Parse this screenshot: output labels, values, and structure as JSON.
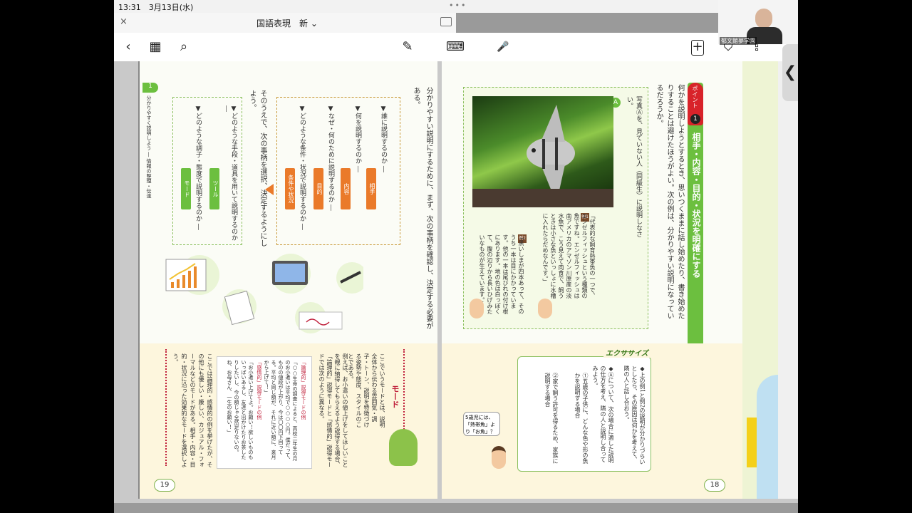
{
  "status": {
    "time": "13:31",
    "date": "3月13日(水)",
    "multitask": "•••"
  },
  "titlebar": {
    "close": "×",
    "title": "国語表現　新 ⌄"
  },
  "toolbar": {
    "back": "‹",
    "grid": "▦",
    "search": "⌕",
    "pen": "✎",
    "keyboard": "⌨",
    "mic": "🎤",
    "add_page": "+",
    "bookmark": "⛉",
    "share": "⇪"
  },
  "camera": {
    "label": "郁文館夢学園"
  },
  "side_handle": "❮",
  "left_page": {
    "section_tab": "1",
    "running_head": "分かりやすく説明しよう ― 情報の整理・伝達",
    "intro": "分かりやすい説明にするために、まず、次の事柄を確認し、決定する必要がある。",
    "q1": "▼誰に説明するのか ―",
    "q2": "▼何を説明するのか ―",
    "q3": "▼なぜ・何のために説明するのか ―",
    "q4": "▼どのような条件・状況で説明するのか ―",
    "tag1": "相手",
    "tag2": "内容",
    "tag3": "目的",
    "tag4": "条件や状況",
    "then": "そのうえで、次の事柄を選択、決定するようにしよう。",
    "q5": "▼どのような手段・道具を用いて説明するのか ―",
    "q6": "▼どのような調子・態度で説明するのか ―",
    "tag5": "ツール",
    "tag6": "モード",
    "mode_title": "モード",
    "mode_text1": "ここでいうモードとは、説明全体から伝わる雰囲気・調子・トーン、説明を特徴づける姿勢や態度、スタイルのことである。",
    "mode_text2": "例えば、お小遣いの値上げをしてほしいことを親に納得してもらえるよう説得する場合、「論理的」説得モードと「感情的」説得モードでは次のように異なる。",
    "ex_logical_title": "「論理的」説得モードの例",
    "ex_logical": "「○○生命の調査によると、高校二年生の月のお小遣いは平均で○○○○円。僕だって、ものの値段が上がり、今は〇〇円下回ってる。平均と同じ額が、それに近い額に、来月から上げて！」",
    "ex_emotional_title": "「感情的」説得モードの例",
    "ex_emotional": "「お小遣い上げてよ。お願い！欲しいものもいっぱいあるし、友達と出かけたりお茶したりしたいし、今の額じゃ全然足りないの。ね、お母さん、一生のお願い！」",
    "mode_text3": "ここでは論理的・感情的の例を挙げたが、その他にも優しい・厳しい、カジュアル・フォーマルなどのモードがある。相手・内容・目的・状況に沿った効果的なモードを選択しよう。",
    "page_number": "19"
  },
  "right_page": {
    "point_label": "ポイント",
    "point_number": "1",
    "heading": "相手・内容・目的・状況を明確にする",
    "intro": "何かを説明しようとするとき、思いつくままに話し始めたり、書き始めたりすることは避けたほうがよい。次の例は、分かりやすい説明になっているだろうか。",
    "photo_prompt": "写真Ⓐを、見ていない人（同級生）に説明しなさい。",
    "photo_label": "A",
    "ex1_label": "例1",
    "ex1": "「代表的な飼育熱帯魚の一つで、エンゼルフィッシュという種類の魚ですね。エンゼルフィッシュは南アメリカのアマゾン川原産の淡水魚で、こう見えて肉食で、飼うときは小さな魚といっしょに水槽に入れたらだめなんです。」",
    "ex2_label": "例2",
    "ex2": "「黒いしまが四本あって、そのうち一本は目にかかっています。他の一本は尾びれの付け根にあります。地の色は白っぽくて、腹の辺りから長いひげみたいなものが生えています。」",
    "exercise_title": "エクササイズ",
    "exercise1": "◆上の例1と例2の説明が分かりづらいとしたら、その原因は何かを考えて、隣の人と話し合おう。",
    "exercise2": "◆Ⓐについて、次の場合に適した説明の仕方を考え、隣の人と説明し合ってみよう。",
    "exercise2a": "①五歳の子供に、どんな色や形の魚かを説明する場合",
    "exercise2b": "②家で飼う許可を得るため、家族に説明する場合",
    "speech": "5歳児には、「熱帯魚」より「お魚」？",
    "page_number": "18"
  }
}
